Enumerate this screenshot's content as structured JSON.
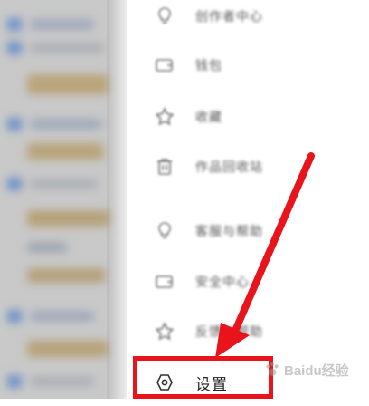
{
  "menu": {
    "items": [
      {
        "label": "创作者中心",
        "icon": "lightbulb-icon"
      },
      {
        "label": "钱包",
        "icon": "wallet-icon"
      },
      {
        "label": "收藏",
        "icon": "star-icon"
      },
      {
        "label": "作品回收站",
        "icon": "trash-icon"
      },
      {
        "label": "客服与帮助",
        "icon": "lightbulb-icon"
      },
      {
        "label": "安全中心",
        "icon": "wallet-icon"
      },
      {
        "label": "反馈与帮助",
        "icon": "star-icon"
      },
      {
        "label": "设置",
        "icon": "settings-icon"
      }
    ]
  },
  "colors": {
    "highlight": "#e8131b",
    "annotation_arrow": "#e8131b"
  },
  "watermark": {
    "text": "Baidu经验"
  }
}
